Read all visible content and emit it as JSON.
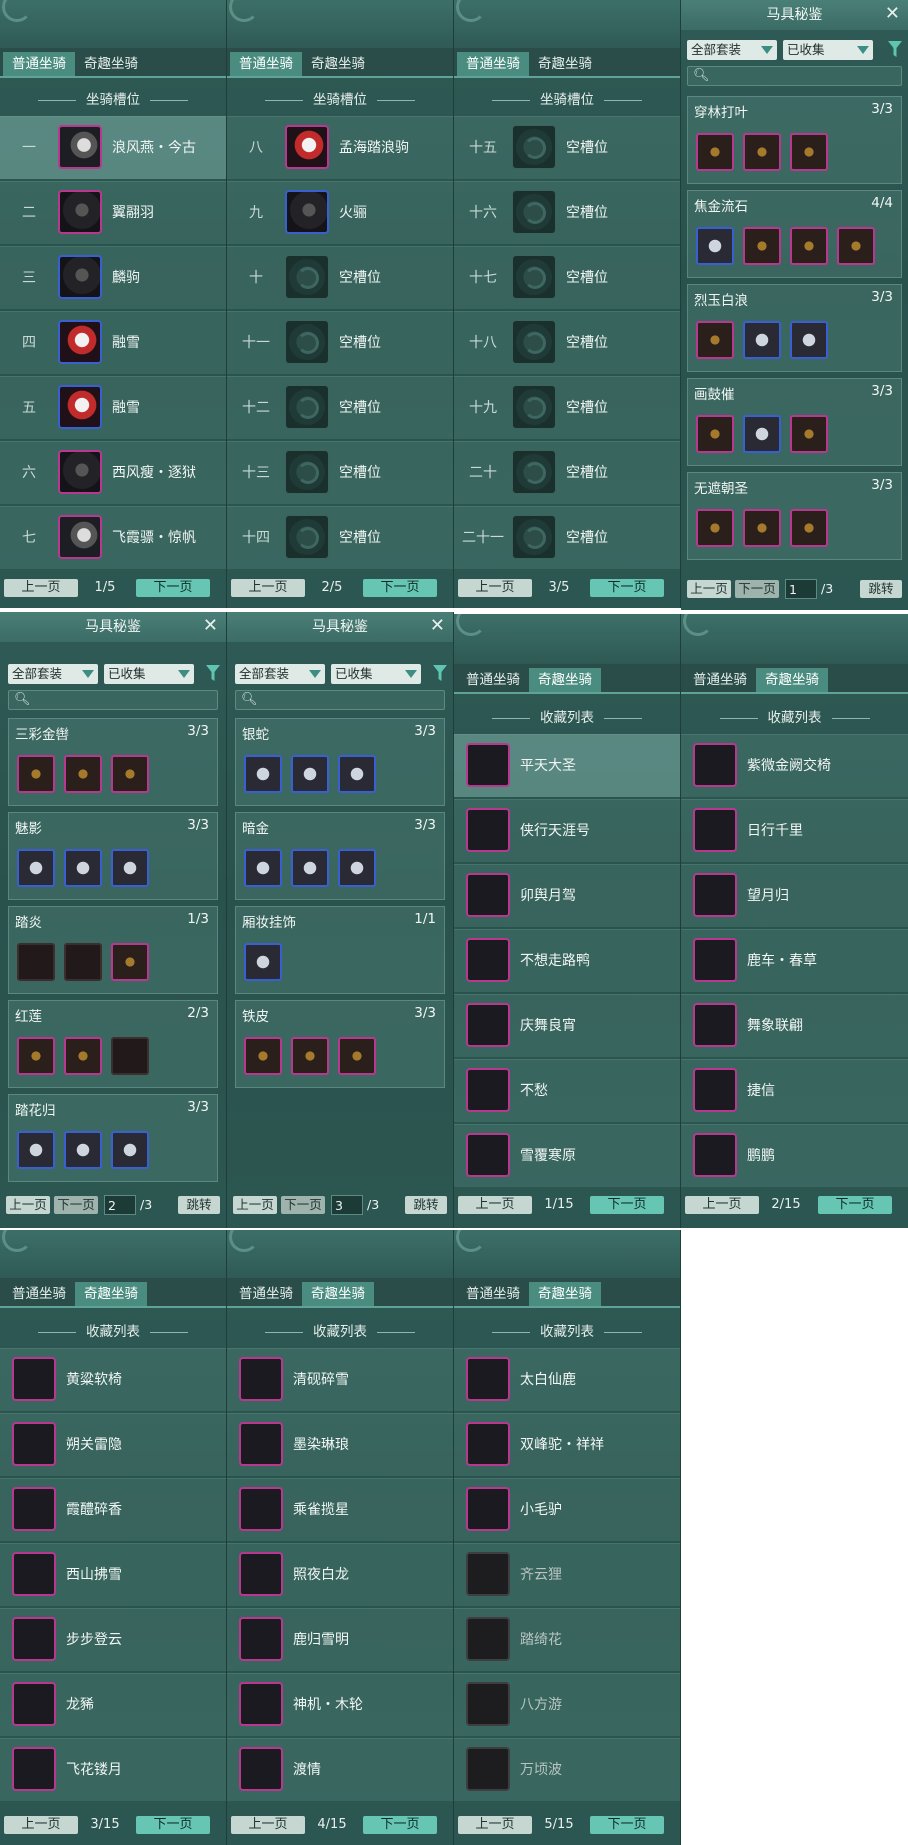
{
  "tabs": {
    "normal": "普通坐骑",
    "odd": "奇趣坐骑"
  },
  "slot_header": "坐骑槽位",
  "collect_header": "收藏列表",
  "prev": "上一页",
  "next": "下一页",
  "jump": "跳转",
  "empty_slot": "空槽位",
  "slot_pages": [
    {
      "page": "1/5",
      "rows": [
        {
          "num": "一",
          "name": "浪风燕・今古",
          "icon": "white-horse-icon"
        },
        {
          "num": "二",
          "name": "翼翮羽",
          "icon": "black-horse-icon"
        },
        {
          "num": "三",
          "name": "麟驹",
          "icon": "black-horse-icon"
        },
        {
          "num": "四",
          "name": "融雪",
          "icon": "red-white-horse-icon"
        },
        {
          "num": "五",
          "name": "融雪",
          "icon": "red-white-horse-icon"
        },
        {
          "num": "六",
          "name": "西风瘦・逐狱",
          "icon": "black-horse-icon"
        },
        {
          "num": "七",
          "name": "飞霞骠・惊帆",
          "icon": "white-horse-icon"
        }
      ]
    },
    {
      "page": "2/5",
      "rows": [
        {
          "num": "八",
          "name": "孟海踏浪驹",
          "icon": "red-white-horse-icon"
        },
        {
          "num": "九",
          "name": "火骊",
          "icon": "black-horse-icon"
        },
        {
          "num": "十",
          "name": "空槽位",
          "icon": "empty-slot-icon"
        },
        {
          "num": "十一",
          "name": "空槽位",
          "icon": "empty-slot-icon"
        },
        {
          "num": "十二",
          "name": "空槽位",
          "icon": "empty-slot-icon"
        },
        {
          "num": "十三",
          "name": "空槽位",
          "icon": "empty-slot-icon"
        },
        {
          "num": "十四",
          "name": "空槽位",
          "icon": "empty-slot-icon"
        }
      ]
    },
    {
      "page": "3/5",
      "rows": [
        {
          "num": "十五",
          "name": "空槽位",
          "icon": "empty-slot-icon"
        },
        {
          "num": "十六",
          "name": "空槽位",
          "icon": "empty-slot-icon"
        },
        {
          "num": "十七",
          "name": "空槽位",
          "icon": "empty-slot-icon"
        },
        {
          "num": "十八",
          "name": "空槽位",
          "icon": "empty-slot-icon"
        },
        {
          "num": "十九",
          "name": "空槽位",
          "icon": "empty-slot-icon"
        },
        {
          "num": "二十",
          "name": "空槽位",
          "icon": "empty-slot-icon"
        },
        {
          "num": "二十一",
          "name": "空槽位",
          "icon": "empty-slot-icon"
        }
      ]
    }
  ],
  "saddle": {
    "title": "马具秘鉴",
    "filter_all": "全部套装",
    "filter_owned": "已收集",
    "pages": [
      {
        "page_input": "1",
        "total": "/3",
        "sets": [
          {
            "name": "穿林打叶",
            "count": "3/3",
            "items": 3,
            "owned": 3
          },
          {
            "name": "焦金流石",
            "count": "4/4",
            "items": 4,
            "owned": 4
          },
          {
            "name": "烈玉白浪",
            "count": "3/3",
            "items": 3,
            "owned": 3
          },
          {
            "name": "画鼓催",
            "count": "3/3",
            "items": 3,
            "owned": 3
          },
          {
            "name": "无遮朝圣",
            "count": "3/3",
            "items": 3,
            "owned": 3
          }
        ]
      },
      {
        "page_input": "2",
        "total": "/3",
        "sets": [
          {
            "name": "三彩金辔",
            "count": "3/3",
            "items": 3,
            "owned": 3
          },
          {
            "name": "魅影",
            "count": "3/3",
            "items": 3,
            "owned": 3
          },
          {
            "name": "踏炎",
            "count": "1/3",
            "items": 3,
            "owned": 1
          },
          {
            "name": "红莲",
            "count": "2/3",
            "items": 3,
            "owned": 2
          },
          {
            "name": "踏花归",
            "count": "3/3",
            "items": 3,
            "owned": 3
          }
        ]
      },
      {
        "page_input": "3",
        "total": "/3",
        "sets": [
          {
            "name": "银蛇",
            "count": "3/3",
            "items": 3,
            "owned": 3
          },
          {
            "name": "暗金",
            "count": "3/3",
            "items": 3,
            "owned": 3
          },
          {
            "name": "厢妆挂饰",
            "count": "1/1",
            "items": 1,
            "owned": 1
          },
          {
            "name": "铁皮",
            "count": "3/3",
            "items": 3,
            "owned": 3
          }
        ]
      }
    ]
  },
  "collect_pages": [
    {
      "page": "1/15",
      "rows": [
        {
          "name": "平天大圣",
          "owned": true
        },
        {
          "name": "侠行天涯号",
          "owned": true
        },
        {
          "name": "卯舆月驾",
          "owned": true
        },
        {
          "name": "不想走路鸭",
          "owned": true
        },
        {
          "name": "庆舞良宵",
          "owned": true
        },
        {
          "name": "不愁",
          "owned": true
        },
        {
          "name": "雪覆寒原",
          "owned": true
        }
      ]
    },
    {
      "page": "2/15",
      "rows": [
        {
          "name": "紫微金阙交椅",
          "owned": true
        },
        {
          "name": "日行千里",
          "owned": true
        },
        {
          "name": "望月归",
          "owned": true
        },
        {
          "name": "鹿车・春草",
          "owned": true
        },
        {
          "name": "舞象联翩",
          "owned": true
        },
        {
          "name": "捷信",
          "owned": true
        },
        {
          "name": "鹏鹏",
          "owned": true
        }
      ]
    },
    {
      "page": "3/15",
      "rows": [
        {
          "name": "黄粱软椅",
          "owned": true
        },
        {
          "name": "朔关雷隐",
          "owned": true
        },
        {
          "name": "霞醴碎香",
          "owned": true
        },
        {
          "name": "西山拂雪",
          "owned": true
        },
        {
          "name": "步步登云",
          "owned": true
        },
        {
          "name": "龙豨",
          "owned": true
        },
        {
          "name": "飞花镂月",
          "owned": true
        }
      ]
    },
    {
      "page": "4/15",
      "rows": [
        {
          "name": "清砚碎雪",
          "owned": true
        },
        {
          "name": "墨染琳琅",
          "owned": true
        },
        {
          "name": "乘雀揽星",
          "owned": true
        },
        {
          "name": "照夜白龙",
          "owned": true
        },
        {
          "name": "鹿归雪明",
          "owned": true
        },
        {
          "name": "神机・木轮",
          "owned": true
        },
        {
          "name": "渡情",
          "owned": true
        }
      ]
    },
    {
      "page": "5/15",
      "rows": [
        {
          "name": "太白仙鹿",
          "owned": true
        },
        {
          "name": "双峰驼・祥祥",
          "owned": true
        },
        {
          "name": "小毛驴",
          "owned": true
        },
        {
          "name": "齐云狸",
          "owned": false
        },
        {
          "name": "踏绮花",
          "owned": false
        },
        {
          "name": "八方游",
          "owned": false
        },
        {
          "name": "万顷波",
          "owned": false
        }
      ]
    }
  ]
}
